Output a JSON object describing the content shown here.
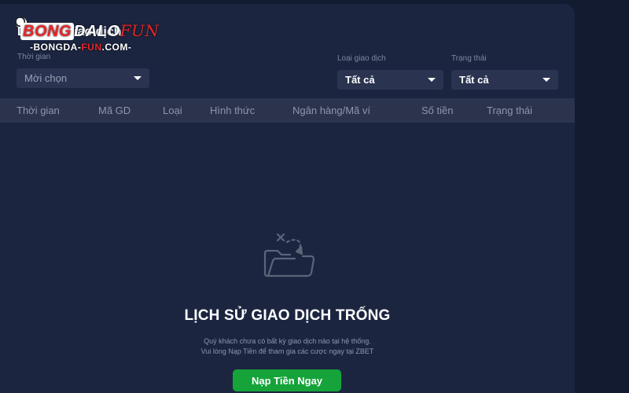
{
  "page": {
    "title": "Lịch sử giao dịch"
  },
  "watermark": {
    "brand_part1": "BONG",
    "brand_part2": "DALO",
    "brand_part3": "FUN",
    "site_prefix": "-BONGDA-",
    "site_red": "FUN",
    "site_suffix": ".COM-"
  },
  "filters": {
    "time": {
      "label": "Thời gian",
      "value": "Mời chọn"
    },
    "type": {
      "label": "Loại giao dịch",
      "value": "Tất cả"
    },
    "status": {
      "label": "Trạng thái",
      "value": "Tất cả"
    }
  },
  "table": {
    "columns": [
      "Thời gian",
      "Mã GD",
      "Loại",
      "Hình thức",
      "Ngân hàng/Mã ví",
      "Số tiền",
      "Trạng thái"
    ]
  },
  "empty": {
    "title": "LỊCH SỬ GIAO DỊCH TRỐNG",
    "line1": "Quý khách chưa có bất kỳ giao dịch nào tại hệ thống.",
    "line2": "Vui lòng Nạp Tiền để tham gia các cược ngay tại ZBET",
    "button": "Nạp Tiền Ngay",
    "icon": "empty-folder-icon"
  },
  "colors": {
    "background": "#131b31",
    "panel": "#1c2540",
    "header_row": "#2b344c",
    "button": "#15a33a"
  }
}
